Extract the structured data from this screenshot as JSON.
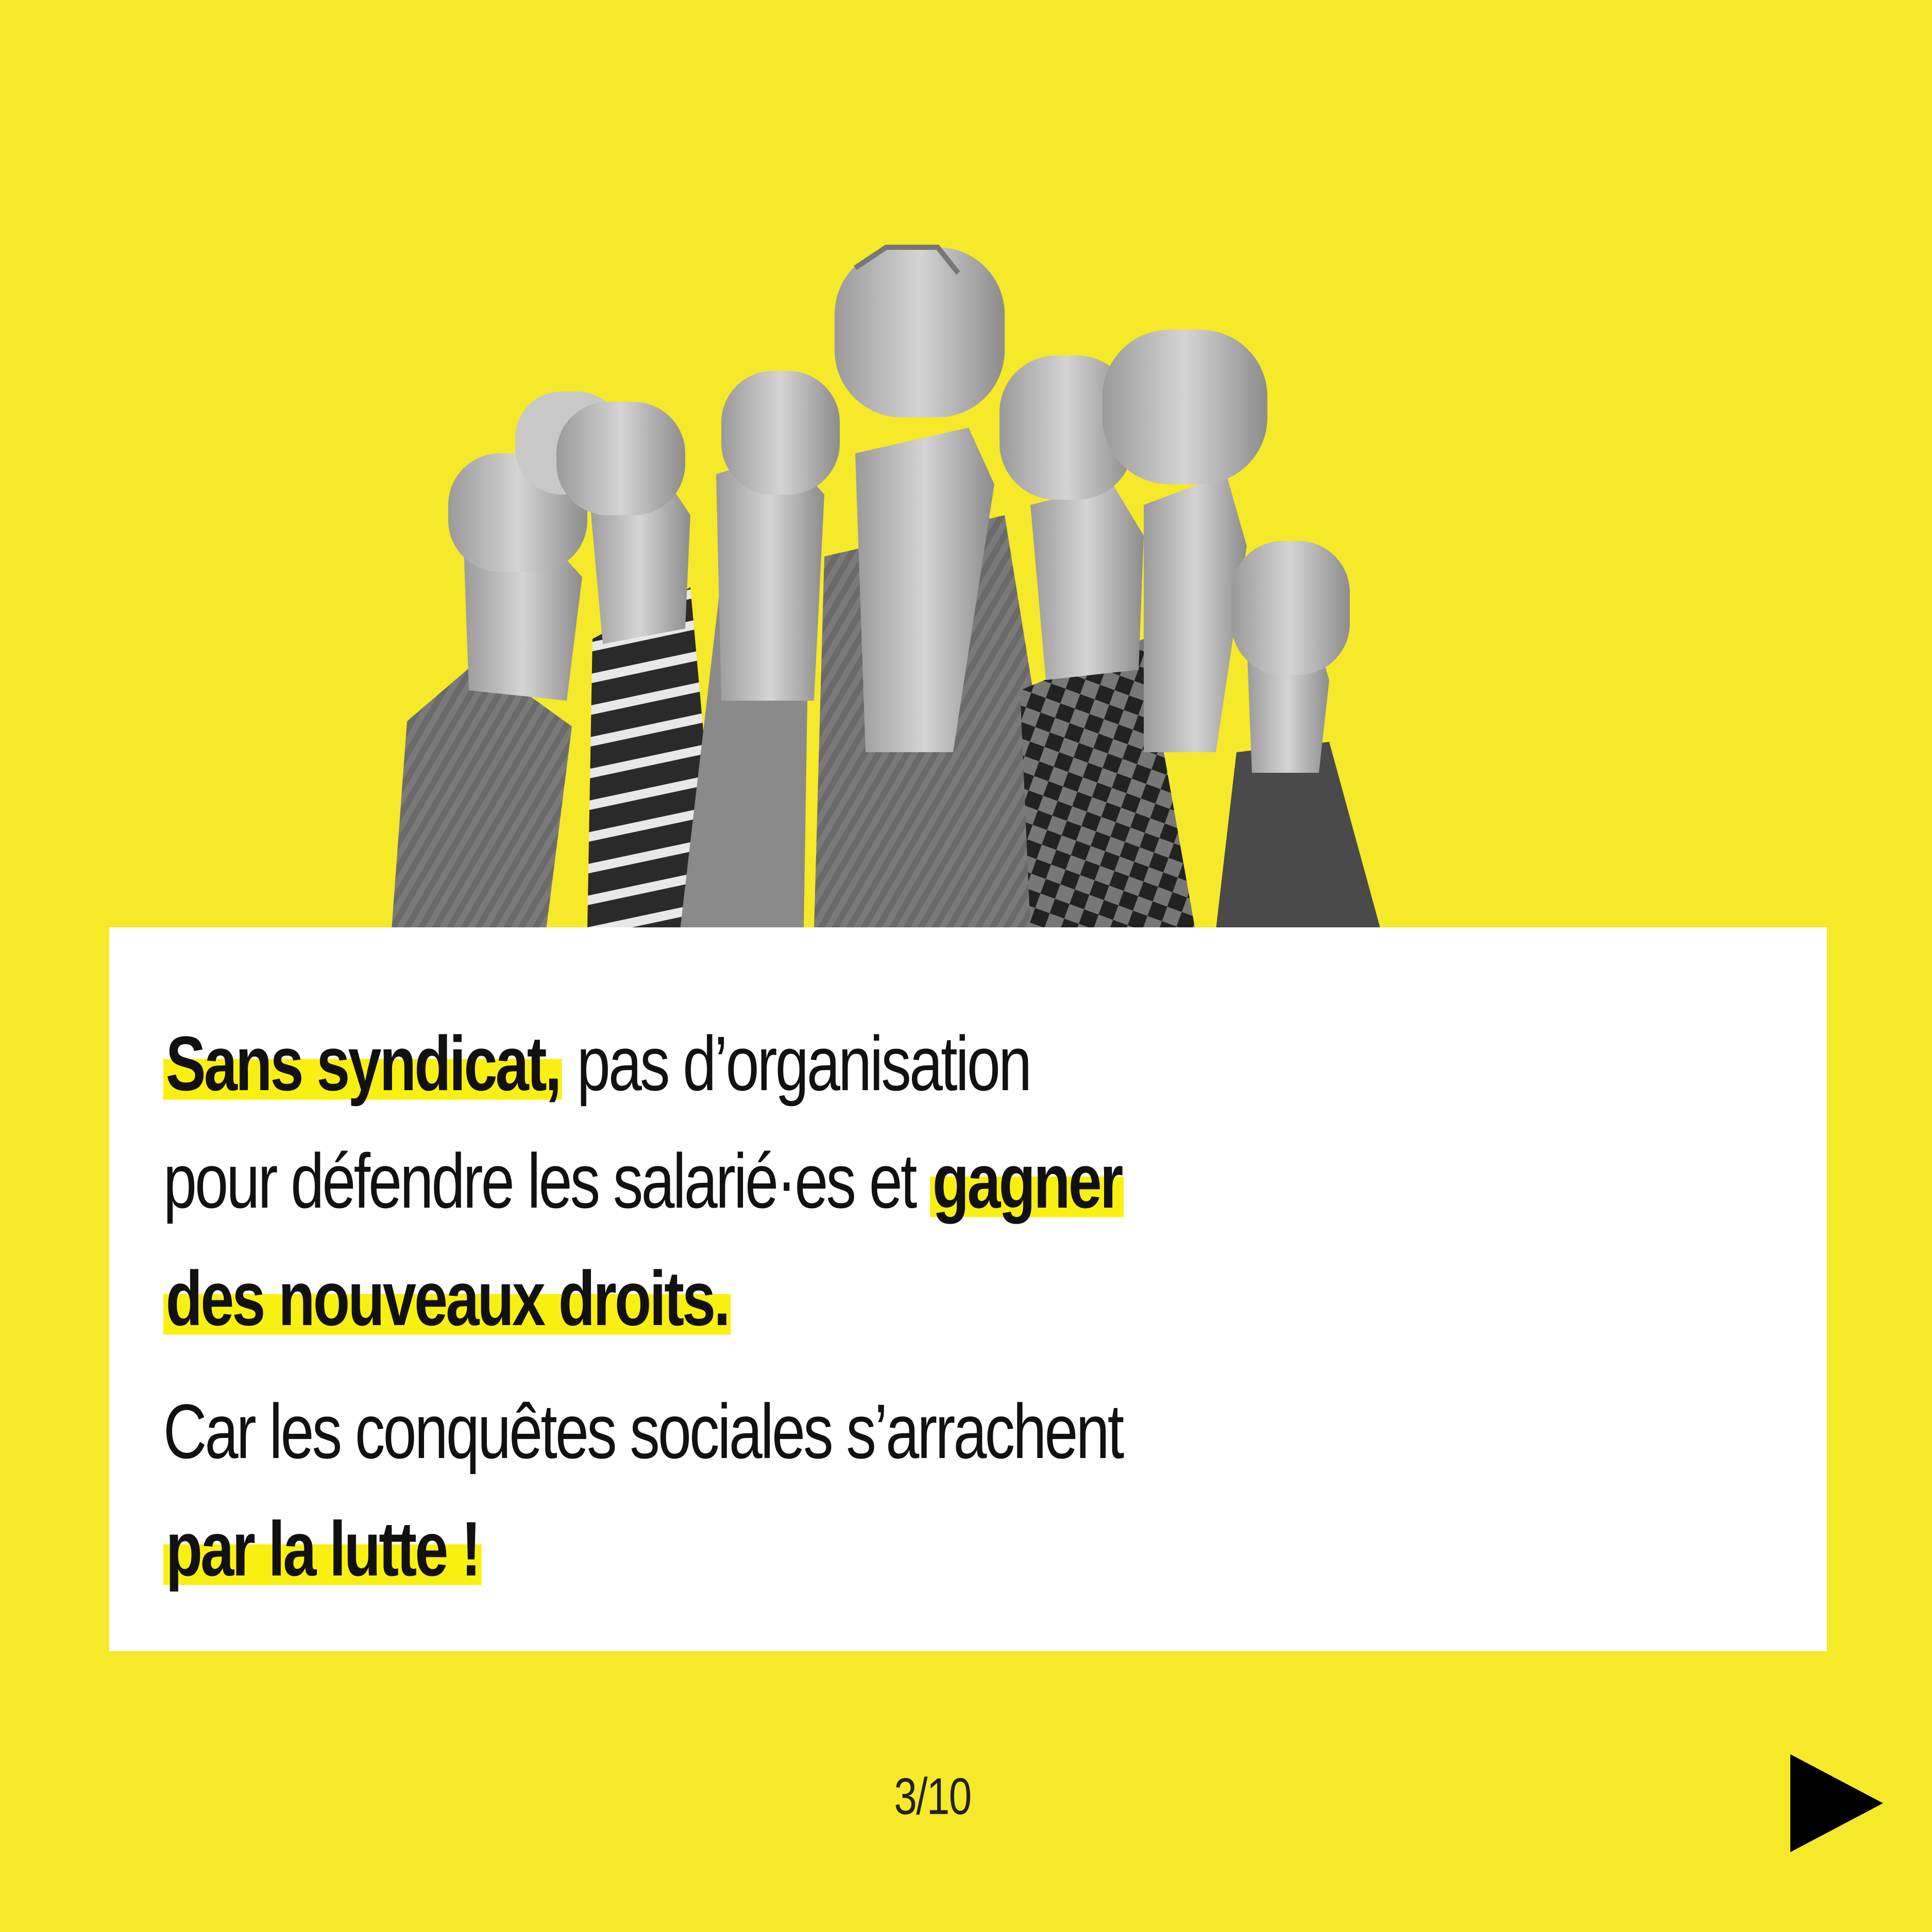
{
  "slide": {
    "paragraph_1": {
      "line_1_highlight": "Sans syndicat,",
      "line_1_rest": " pas d’organisation",
      "line_2_text": "pour défendre les salarié·es et ",
      "line_2_highlight": "gagner",
      "line_3_highlight": "des nouveaux droits."
    },
    "paragraph_2": {
      "line_1_text": "Car les conquêtes sociales s’arrachent",
      "line_2_highlight": "par la lutte !"
    }
  },
  "footer": {
    "page_indicator": "3/10",
    "next_icon": "play-triangle-icon"
  },
  "colors": {
    "background": "#f5e92a",
    "highlight": "#f9f012",
    "card": "#ffffff",
    "text": "#111111"
  }
}
